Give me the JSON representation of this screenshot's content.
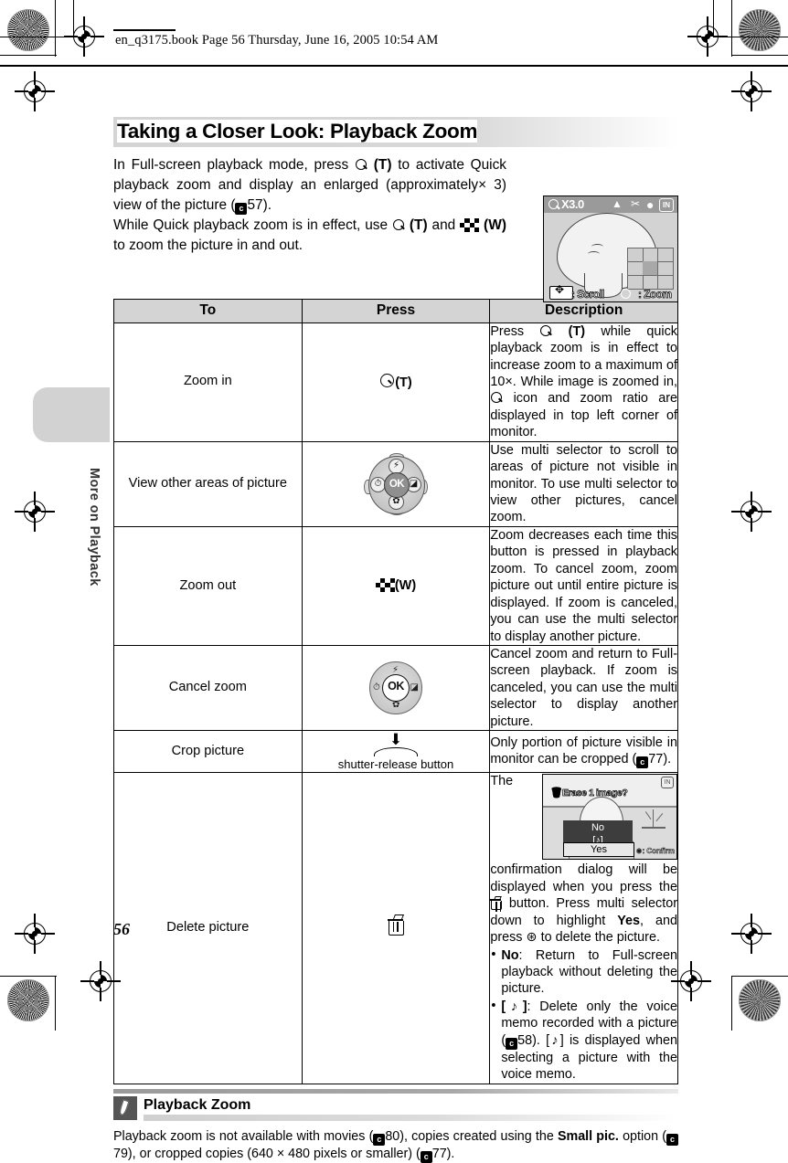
{
  "printer_header": {
    "text": "en_q3175.book  Page 56  Thursday, June 16, 2005  10:54 AM"
  },
  "page": {
    "title": "Taking a Closer Look: Playback Zoom",
    "number": "56",
    "side_tab_label": "More on Playback"
  },
  "intro": {
    "para1_a": "In Full-screen playback mode, press ",
    "para1_t": "(T)",
    "para1_b": " to activate Quick playback zoom and display an enlarged (approximately× 3) view of the picture (",
    "para1_ref": "57",
    "para1_c": ").",
    "para2_a": "While Quick playback zoom is in effect, use ",
    "para2_t": "(T)",
    "para2_b": " and ",
    "para2_w": "(W)",
    "para2_c": " to zoom the picture in and out."
  },
  "lcd_monitor": {
    "zoom_ratio": "X3.0",
    "scroll_label": ": Scroll",
    "zoom_label": ": Zoom",
    "memory_label": "IN"
  },
  "table": {
    "headers": [
      "To",
      "Press",
      "Description"
    ],
    "rows": [
      {
        "to": "Zoom in",
        "press_label": "(T)",
        "press_icon": "magnifier-icon",
        "desc_a": "Press ",
        "desc_t": "(T)",
        "desc_b": " while quick playback zoom is in effect to increase zoom to a maximum of 10×. While image is zoomed in, ",
        "desc_c": " icon and zoom ratio are displayed in top left corner of monitor."
      },
      {
        "to": "View other areas of picture",
        "press_icon": "multi-selector-icon",
        "desc": "Use multi selector to scroll to areas of picture not visible in monitor. To use multi selector to view other pictures, cancel zoom."
      },
      {
        "to": "Zoom out",
        "press_label": "(W)",
        "press_icon": "thumbnail-checkerboard-icon",
        "desc": "Zoom decreases each time this button is pressed in playback zoom. To cancel zoom, zoom picture out until entire picture is displayed. If zoom is canceled, you can use the multi selector to display another picture."
      },
      {
        "to": "Cancel zoom",
        "press_icon": "ok-button-icon",
        "desc": "Cancel zoom and return to Full-screen playback. If zoom is canceled, you can use the multi selector to display another picture."
      },
      {
        "to": "Crop picture",
        "press_label": "shutter-release button",
        "press_icon": "shutter-release-button-icon",
        "desc_a": "Only portion of picture visible in monitor can be cropped (",
        "desc_ref": "77",
        "desc_b": ")."
      },
      {
        "to": "Delete picture",
        "press_icon": "trash-icon",
        "desc_a": "The confirmation dialog will be displayed when you press the ",
        "desc_b": " button. Press multi selector down to highlight ",
        "desc_yes": "Yes",
        "desc_c": ", and press ",
        "desc_d": " to delete the picture.",
        "bullet1_label": "No",
        "bullet1_text": ": Return to Full-screen playback without deleting the picture.",
        "bullet2_label": "[♪]",
        "bullet2_a": ": Delete only the voice memo recorded with a picture (",
        "bullet2_ref": "58",
        "bullet2_b": "). [♪] is displayed when selecting a picture with the voice memo."
      }
    ]
  },
  "delete_dialog": {
    "title": "Erase 1 image?",
    "option_no": "No",
    "option_memo": "[♪]",
    "option_yes": "Yes",
    "confirm_hint": ": Confirm",
    "memory_label": "IN"
  },
  "note": {
    "title": "Playback Zoom",
    "text_a": "Playback zoom is not available with movies (",
    "ref1": "80",
    "text_b": "), copies created using the ",
    "bold1": "Small pic.",
    "text_c": " option (",
    "ref2": "79",
    "text_d": "), or cropped copies (640 × 480 pixels or smaller) (",
    "ref3": "77",
    "text_e": ")."
  }
}
